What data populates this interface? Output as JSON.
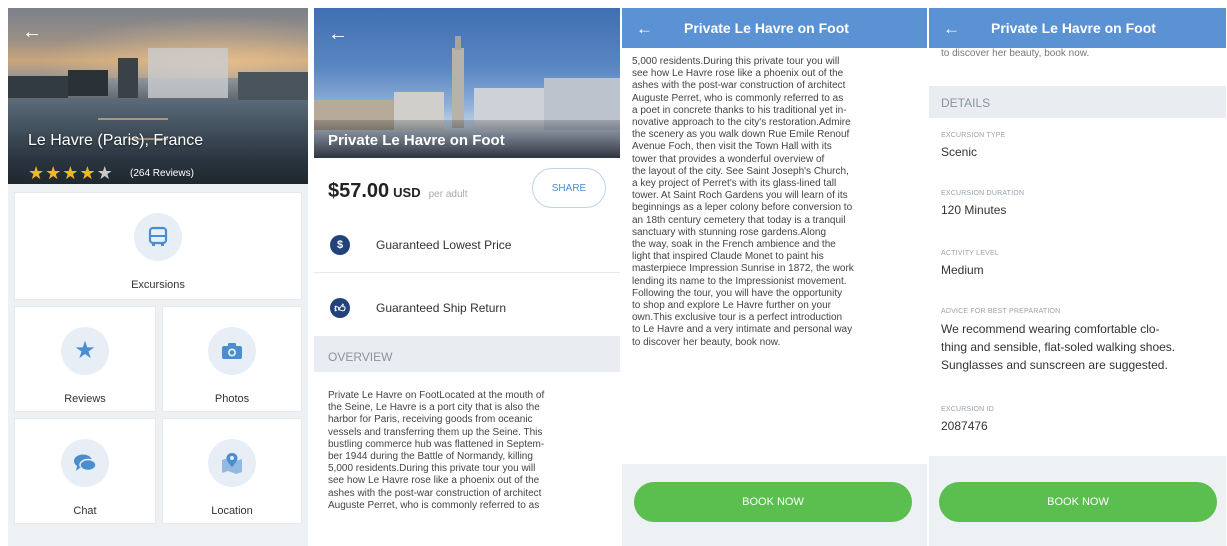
{
  "screen1": {
    "location_title": "Le Havre (Paris), France",
    "rating": 4,
    "rating_max": 5,
    "reviews_count": "(264 Reviews)",
    "tiles": {
      "excursions": "Excursions",
      "reviews": "Reviews",
      "photos": "Photos",
      "chat": "Chat",
      "location": "Location"
    }
  },
  "screen2": {
    "hero_title": "Private Le Havre on Foot",
    "price": "$57.00",
    "currency": "USD",
    "per": "per adult",
    "share_label": "SHARE",
    "features": [
      "Guaranteed Lowest Price",
      "Guaranteed Ship Return"
    ],
    "overview_heading": "OVERVIEW",
    "overview_lines": [
      "Private Le Havre on FootLocated at the mouth of",
      "the Seine, Le Havre is a port city that is also the",
      "harbor for Paris, receiving goods from oceanic",
      "vessels and transferring them up the Seine. This",
      "bustling commerce hub was flattened in Septem-",
      "ber 1944 during the Battle of Normandy, killing",
      "5,000 residents.During this private tour you will",
      "see how Le Havre rose like a phoenix out of the",
      "ashes with the post-war construction of architect",
      "Auguste Perret, who is commonly referred to as"
    ]
  },
  "screen3": {
    "header_title": "Private Le Havre on Foot",
    "body_lines": [
      "5,000 residents.During this private tour you will",
      "see how Le Havre rose like a phoenix out of the",
      "ashes with the post-war construction of architect",
      "Auguste Perret, who is commonly referred to as",
      "a poet in concrete thanks to his traditional yet in-",
      "novative approach to the city's restoration.Admire",
      "the scenery as you walk down Rue Emile Renouf",
      "Avenue Foch, then visit the Town Hall with its",
      "tower that provides a wonderful overview of",
      "the layout of the city. See Saint Joseph's Church,",
      "a key project of Perret's with its glass-lined tall",
      "tower. At Saint Roch Gardens you will learn of its",
      "beginnings as a leper colony before conversion to",
      "an 18th century cemetery that today is a tranquil",
      "sanctuary with stunning rose gardens.Along",
      "the way, soak in the French ambience and the",
      "light that inspired Claude Monet to paint his",
      "masterpiece Impression Sunrise in 1872, the work",
      "lending its name to the Impressionist movement.",
      "Following the tour, you will have the opportunity",
      "to shop and explore Le Havre further on your",
      "own.This exclusive tour is a perfect introduction",
      "to Le Havre and a very intimate and personal way",
      "to discover her beauty, book now."
    ],
    "book_label": "BOOK NOW"
  },
  "screen4": {
    "header_title": "Private Le Havre on Foot",
    "cut_line": "to discover her beauty, book now.",
    "details_heading": "DETAILS",
    "fields": [
      {
        "label": "EXCURSION TYPE",
        "value": "Scenic"
      },
      {
        "label": "EXCURSION DURATION",
        "value": "120 Minutes"
      },
      {
        "label": "ACTIVITY LEVEL",
        "value": "Medium"
      },
      {
        "label": "ADVICE FOR BEST PREPARATION",
        "value": "We recommend wearing comfortable clo-\nthing and sensible, flat-soled walking shoes.\nSunglasses and sunscreen are suggested."
      },
      {
        "label": "EXCURSION ID",
        "value": "2087476"
      }
    ],
    "book_label": "BOOK NOW"
  },
  "colors": {
    "header_blue": "#5a92d4",
    "book_green": "#5bbf4f",
    "star_gold": "#f5b623",
    "icon_navy": "#23427a"
  }
}
